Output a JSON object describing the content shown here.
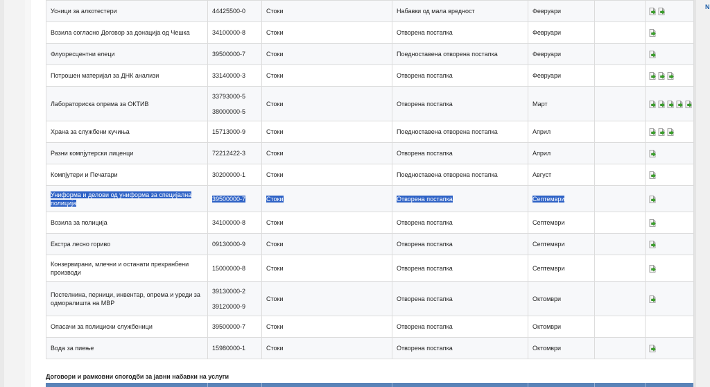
{
  "window_edge_letter": "N",
  "rows": [
    {
      "name": "Усници за алкотестери",
      "cpv": [
        "44425500-0"
      ],
      "type": "Стоки",
      "procedure": "Набавки од мала вредност",
      "month": "Февруари",
      "docs": 2,
      "selected": false
    },
    {
      "name": "Возила согласно Договор за донација од Чешка",
      "cpv": [
        "34100000-8"
      ],
      "type": "Стоки",
      "procedure": "Отворена постапка",
      "month": "Февруари",
      "docs": 1,
      "selected": false
    },
    {
      "name": "Флуоресцентни елеци",
      "cpv": [
        "39500000-7"
      ],
      "type": "Стоки",
      "procedure": "Поедноставена отворена постапка",
      "month": "Февруари",
      "docs": 1,
      "selected": false
    },
    {
      "name": "Потрошен материјал за ДНК анализи",
      "cpv": [
        "33140000-3"
      ],
      "type": "Стоки",
      "procedure": "Отворена постапка",
      "month": "Февруари",
      "docs": 3,
      "selected": false
    },
    {
      "name": "Лабораториска опрема за ОКТИВ",
      "cpv": [
        "33793000-5",
        "38000000-5"
      ],
      "type": "Стоки",
      "procedure": "Отворена постапка",
      "month": "Март",
      "docs": 5,
      "selected": false
    },
    {
      "name": "Храна за службени кучиња",
      "cpv": [
        "15713000-9"
      ],
      "type": "Стоки",
      "procedure": "Поедноставена отворена постапка",
      "month": "Април",
      "docs": 3,
      "selected": false
    },
    {
      "name": "Разни компјутерски лиценци",
      "cpv": [
        "72212422-3"
      ],
      "type": "Стоки",
      "procedure": "Отворена постапка",
      "month": "Април",
      "docs": 1,
      "selected": false
    },
    {
      "name": "Компјутери и Печатари",
      "cpv": [
        "30200000-1"
      ],
      "type": "Стоки",
      "procedure": "Поедноставена отворена постапка",
      "month": "Август",
      "docs": 1,
      "selected": false
    },
    {
      "name": "Униформа и делови од униформа за специјална полиција",
      "cpv": [
        "39500000-7"
      ],
      "type": "Стоки",
      "procedure": "Отворена постапка",
      "month": "Септември",
      "docs": 1,
      "selected": true
    },
    {
      "name": "Возила за полиција",
      "cpv": [
        "34100000-8"
      ],
      "type": "Стоки",
      "procedure": "Отворена постапка",
      "month": "Септември",
      "docs": 1,
      "selected": false
    },
    {
      "name": "Екстра лесно гориво",
      "cpv": [
        "09130000-9"
      ],
      "type": "Стоки",
      "procedure": "Отворена постапка",
      "month": "Септември",
      "docs": 1,
      "selected": false
    },
    {
      "name": "Конзервирани, млечни и останати прехранбени производи",
      "cpv": [
        "15000000-8"
      ],
      "type": "Стоки",
      "procedure": "Отворена постапка",
      "month": "Септември",
      "docs": 1,
      "selected": false
    },
    {
      "name": "Постелнина, перници, инвентар, опрема и уреди за одморалишта на МВР",
      "cpv": [
        "39130000-2",
        "39120000-9"
      ],
      "type": "Стоки",
      "procedure": "Отворена постапка",
      "month": "Октомври",
      "docs": 1,
      "selected": false
    },
    {
      "name": "Опасачи за полициски службеници",
      "cpv": [
        "39500000-7"
      ],
      "type": "Стоки",
      "procedure": "Отворена постапка",
      "month": "Октомври",
      "docs": 0,
      "selected": false
    },
    {
      "name": "Вода за пиење",
      "cpv": [
        "15980000-1"
      ],
      "type": "Стоки",
      "procedure": "Отворена постапка",
      "month": "Октомври",
      "docs": 1,
      "selected": false
    }
  ],
  "services_section_title": "Договори и рамковни спогодби за јавни набавки на услуги",
  "colors": {
    "selection": "#2e62c6",
    "header_bar": "#5a83b8",
    "icon_arrow": "#3aa52a"
  }
}
